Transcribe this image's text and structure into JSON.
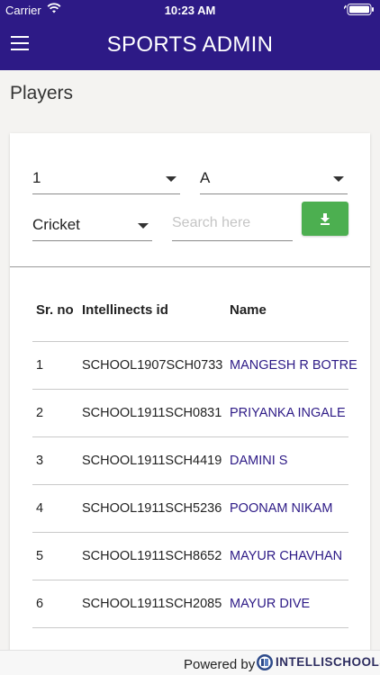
{
  "status_bar": {
    "carrier": "Carrier",
    "time": "10:23 AM"
  },
  "app_bar": {
    "title": "SPORTS ADMIN",
    "menu_icon": "hamburger-menu-icon"
  },
  "page": {
    "title": "Players"
  },
  "filters": {
    "class_value": "1",
    "division_value": "A",
    "sport_value": "Cricket",
    "search_placeholder": "Search here",
    "download_icon": "download-icon",
    "download_color": "#4caf50"
  },
  "table": {
    "headers": {
      "sr_no": "Sr. no",
      "id": "Intellinects id",
      "name": "Name"
    },
    "rows": [
      {
        "sr": "1",
        "id": "SCHOOL1907SCH0733",
        "name": "MANGESH R BOTRE"
      },
      {
        "sr": "2",
        "id": "SCHOOL1911SCH0831",
        "name": "PRIYANKA INGALE"
      },
      {
        "sr": "3",
        "id": "SCHOOL1911SCH4419",
        "name": "DAMINI S"
      },
      {
        "sr": "4",
        "id": "SCHOOL1911SCH5236",
        "name": "POONAM NIKAM"
      },
      {
        "sr": "5",
        "id": "SCHOOL1911SCH8652",
        "name": "MAYUR CHAVHAN"
      },
      {
        "sr": "6",
        "id": "SCHOOL1911SCH2085",
        "name": "MAYUR DIVE"
      }
    ]
  },
  "footer": {
    "powered_by": "Powered by",
    "brand": "INTELLISCHOOLS"
  },
  "colors": {
    "primary": "#2d1a86",
    "accent": "#4caf50",
    "link": "#2d1a86"
  }
}
